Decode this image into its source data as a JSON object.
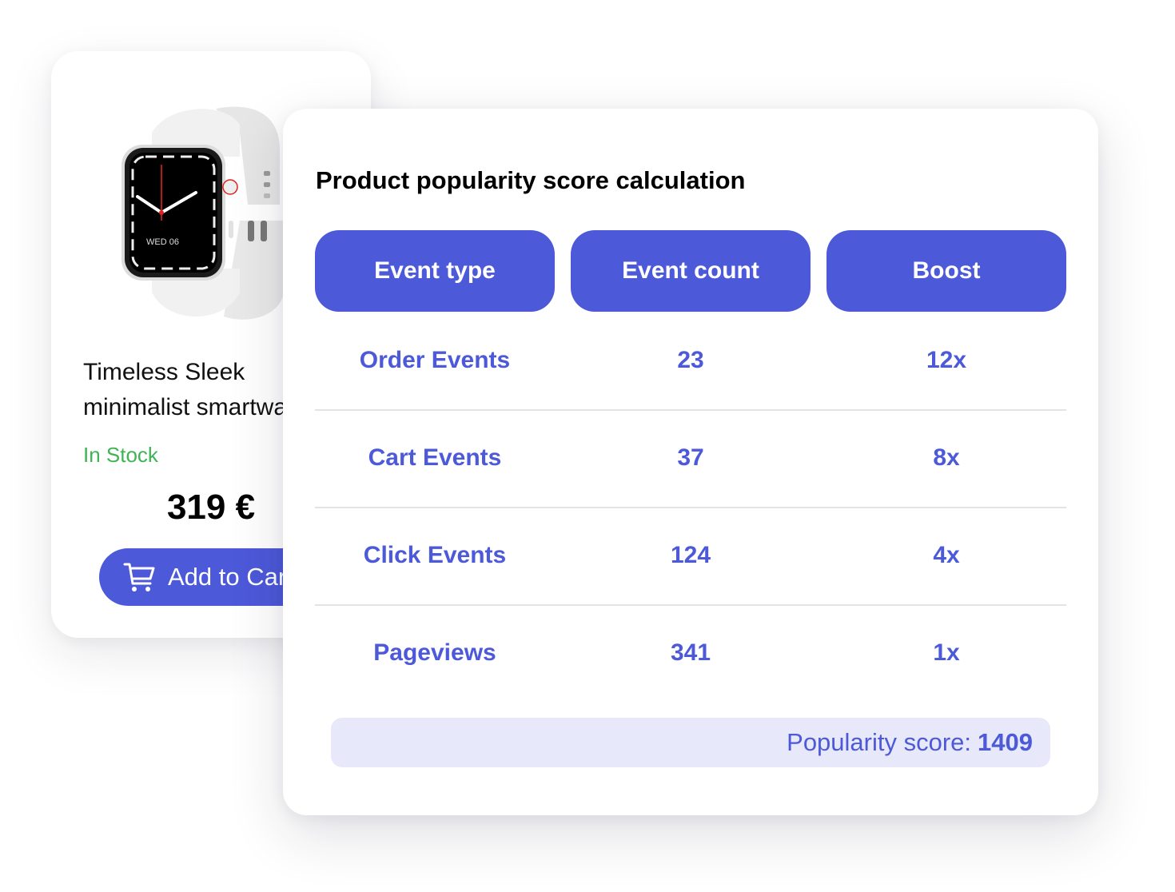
{
  "product_card": {
    "image_alt": "white smartwatch",
    "watch_face_text": "WED 06",
    "title": "Timeless Sleek minimalist smartwatch",
    "stock_status": "In Stock",
    "price": "319 €",
    "add_to_cart_label": "Add to Cart",
    "icons": {
      "cart": "cart-icon"
    },
    "colors": {
      "accent": "#4c59d9",
      "stock": "#3fb454"
    }
  },
  "score_card": {
    "title": "Product popularity score calculation",
    "columns": [
      "Event type",
      "Event count",
      "Boost"
    ],
    "rows": [
      {
        "event_type": "Order Events",
        "event_count": "23",
        "boost": "12x"
      },
      {
        "event_type": "Cart Events",
        "event_count": "37",
        "boost": "8x"
      },
      {
        "event_type": "Click Events",
        "event_count": "124",
        "boost": "4x"
      },
      {
        "event_type": "Pageviews",
        "event_count": "341",
        "boost": "1x"
      }
    ],
    "total_label": "Popularity score:",
    "total_value": "1409",
    "colors": {
      "accent": "#4c59d9",
      "total_bg": "#e7e8f9"
    }
  }
}
